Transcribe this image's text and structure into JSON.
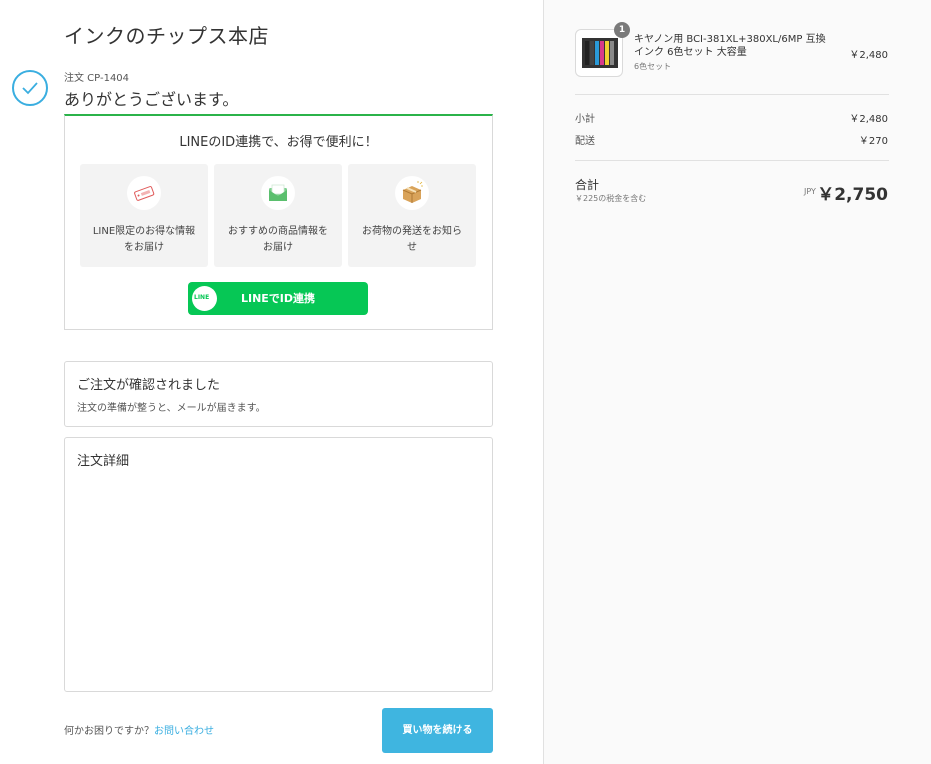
{
  "shop_name": "インクのチップス本店",
  "order": {
    "number": "注文 CP-1404",
    "thanks": "ありがとうございます。"
  },
  "line_promo": {
    "title": "LINEのID連携で、お得で便利に！",
    "features": [
      {
        "icon": "sale-tag-icon",
        "text": "LINE限定のお得な情報をお届け"
      },
      {
        "icon": "envelope-icon",
        "text": "おすすめの商品情報をお届け"
      },
      {
        "icon": "package-icon",
        "text": "お荷物の発送をお知らせ"
      }
    ],
    "logo_text": "LINE",
    "button_label": "LINEでID連携"
  },
  "confirmation": {
    "title": "ご注文が確認されました",
    "subtitle": "注文の準備が整うと、メールが届きます。"
  },
  "details": {
    "title": "注文詳細"
  },
  "footer": {
    "help_text": "何かお困りですか？",
    "contact_link": "お問い合わせ",
    "continue_button": "買い物を続ける"
  },
  "summary": {
    "product": {
      "quantity": "1",
      "name": "キヤノン用 BCI-381XL+380XL/6MP 互換インク 6色セット 大容量",
      "variant": "6色セット",
      "price": "￥2,480"
    },
    "subtotal_label": "小計",
    "subtotal_value": "￥2,480",
    "shipping_label": "配送",
    "shipping_value": "￥270",
    "total_label": "合計",
    "tax_note": "￥225の税金を含む",
    "currency": "JPY",
    "total_value": "￥2,750"
  },
  "colors": {
    "accent": "#3aaee0",
    "line_green": "#06c755",
    "sidebar_bg": "#fafafa"
  }
}
